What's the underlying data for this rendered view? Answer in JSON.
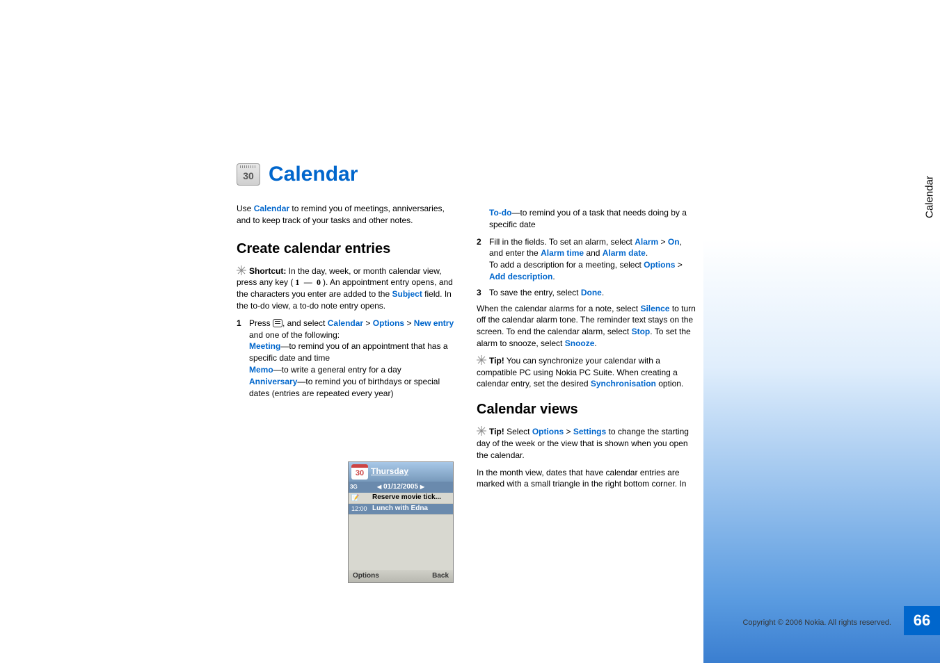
{
  "chapter": {
    "icon_number": "30",
    "title": "Calendar"
  },
  "intro": {
    "prefix": "Use ",
    "link": "Calendar",
    "suffix": " to remind you of meetings, anniversaries, and to keep track of your tasks and other notes."
  },
  "section_create": "Create calendar entries",
  "shortcut": {
    "label": "Shortcut:",
    "text_a": " In the day, week, or month calendar view, press any key (",
    "key1": "1",
    "dash": " — ",
    "key0": "0",
    "text_b": "). An appointment entry opens, and the characters you enter are added to the ",
    "subject": "Subject",
    "text_c": " field. In the to-do view, a to-do note entry opens."
  },
  "step1": {
    "num": "1",
    "press": "Press ",
    "and_select": ", and select ",
    "cal": "Calendar",
    "gt1": " > ",
    "opt": "Options",
    "gt2": " > ",
    "newentry": "New entry",
    "and_following": " and one of the following:",
    "meeting": "Meeting",
    "meeting_text": "—to remind you of an appointment that has a specific date and time",
    "memo": "Memo",
    "memo_text": "—to write a general entry for a day",
    "anniv": "Anniversary",
    "anniv_text": "—to remind you of birthdays or special dates (entries are repeated every year)",
    "todo": "To-do",
    "todo_text": "—to remind you of a task that needs doing by a specific date"
  },
  "step2": {
    "num": "2",
    "a": "Fill in the fields. To set an alarm, select ",
    "alarm": "Alarm",
    "gt": " > ",
    "on": "On",
    "b": ", and enter the ",
    "alarm_time": "Alarm time",
    "and": " and ",
    "alarm_date": "Alarm date",
    "c": ".",
    "line2a": "To add a description for a meeting, select ",
    "options": "Options",
    "gt2": " > ",
    "add_desc": "Add description",
    "line2b": "."
  },
  "step3": {
    "num": "3",
    "a": "To save the entry, select ",
    "done": "Done",
    "b": "."
  },
  "alarm_para": {
    "a": "When the calendar alarms for a note, select ",
    "silence": "Silence",
    "b": " to turn off the calendar alarm tone. The reminder text stays on the screen. To end the calendar alarm, select ",
    "stop": "Stop",
    "c": ". To set the alarm to snooze, select ",
    "snooze": "Snooze",
    "d": "."
  },
  "tip_sync": {
    "label": "Tip!",
    "a": " You can synchronize your calendar with a compatible PC using Nokia PC Suite. When creating a calendar entry, set the desired ",
    "sync": "Synchronisation",
    "b": " option."
  },
  "section_views": "Calendar views",
  "tip_views": {
    "label": "Tip!",
    "a": " Select ",
    "options": "Options",
    "gt": " > ",
    "settings": "Settings",
    "b": " to change the starting day of the week or the view that is shown when you open the calendar."
  },
  "month_para": "In the month view, dates that have calendar entries are marked with a small triangle in the right bottom corner. In",
  "phone": {
    "cal_num": "30",
    "day": "Thursday",
    "date": "01/12/2005",
    "threeg": "3G",
    "entry1": "Reserve movie tick...",
    "entry2_time": "12:00",
    "entry2": "Lunch with Edna",
    "left": "Options",
    "right": "Back"
  },
  "sidebar_tab": "Calendar",
  "page_number": "66",
  "copyright": "Copyright © 2006 Nokia. All rights reserved."
}
